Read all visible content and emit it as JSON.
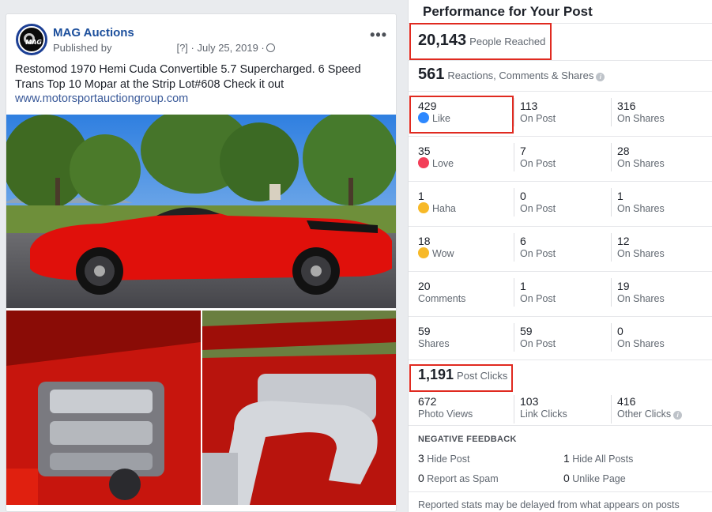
{
  "post": {
    "page_name": "MAG Auctions",
    "published_by": "Published by",
    "meta": "[?] · July 25, 2019 ·",
    "avatar_text": "MAG",
    "caption": "Restomod 1970 Hemi Cuda Convertible 5.7 Supercharged. 6 Speed Trans Top 10 Mopar at the Strip Lot#608 Check it out",
    "link": "www.motorsportauctiongroup.com",
    "more": "•••"
  },
  "panel": {
    "title": "Performance for Your Post",
    "people_reached": {
      "value": "20,143",
      "label": "People Reached"
    },
    "engagement": {
      "value": "561",
      "label": "Reactions, Comments & Shares"
    },
    "rows": [
      {
        "total": "429",
        "label": "Like",
        "reaction": "like",
        "on_post": "113",
        "on_post_label": "On Post",
        "on_shares": "316",
        "on_shares_label": "On Shares"
      },
      {
        "total": "35",
        "label": "Love",
        "reaction": "love",
        "on_post": "7",
        "on_post_label": "On Post",
        "on_shares": "28",
        "on_shares_label": "On Shares"
      },
      {
        "total": "1",
        "label": "Haha",
        "reaction": "haha",
        "on_post": "0",
        "on_post_label": "On Post",
        "on_shares": "1",
        "on_shares_label": "On Shares"
      },
      {
        "total": "18",
        "label": "Wow",
        "reaction": "wow",
        "on_post": "6",
        "on_post_label": "On Post",
        "on_shares": "12",
        "on_shares_label": "On Shares"
      },
      {
        "total": "20",
        "label": "Comments",
        "reaction": "",
        "on_post": "1",
        "on_post_label": "On Post",
        "on_shares": "19",
        "on_shares_label": "On Shares"
      },
      {
        "total": "59",
        "label": "Shares",
        "reaction": "",
        "on_post": "59",
        "on_post_label": "On Post",
        "on_shares": "0",
        "on_shares_label": "On Shares"
      }
    ],
    "post_clicks": {
      "value": "1,191",
      "label": "Post Clicks"
    },
    "clicks": [
      {
        "value": "672",
        "label": "Photo Views"
      },
      {
        "value": "103",
        "label": "Link Clicks"
      },
      {
        "value": "416",
        "label": "Other Clicks"
      }
    ],
    "negative": {
      "title": "NEGATIVE FEEDBACK",
      "items": [
        {
          "value": "3",
          "label": "Hide Post"
        },
        {
          "value": "1",
          "label": "Hide All Posts"
        },
        {
          "value": "0",
          "label": "Report as Spam"
        },
        {
          "value": "0",
          "label": "Unlike Page"
        }
      ]
    },
    "footnote": "Reported stats may be delayed from what appears on posts"
  },
  "colors": {
    "highlight": "#e02a20",
    "link": "#385898",
    "page_name": "#1c4f9c"
  }
}
